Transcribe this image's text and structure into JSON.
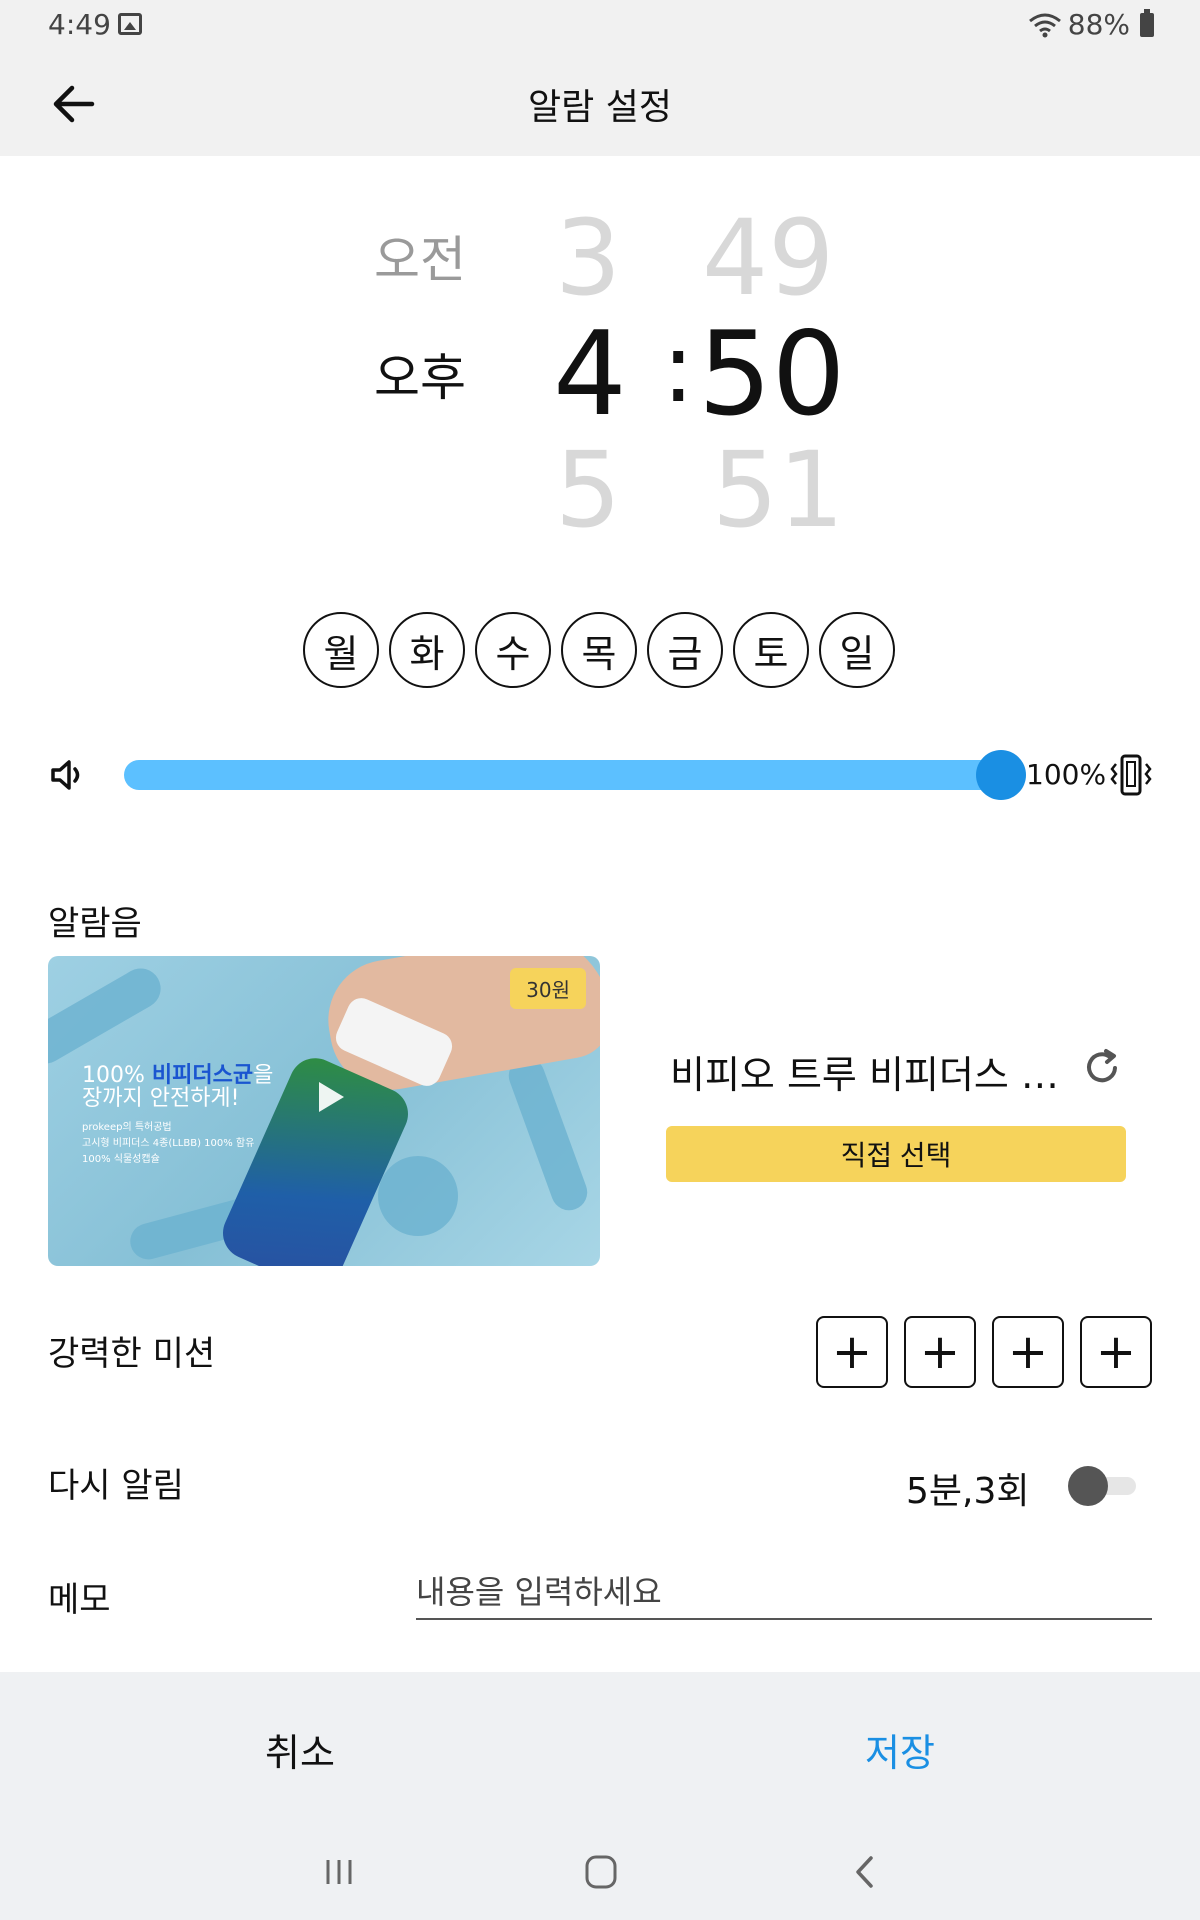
{
  "status_bar": {
    "time": "4:49",
    "battery": "88%"
  },
  "app_bar": {
    "title": "알람 설정"
  },
  "time_picker": {
    "am_label": "오전",
    "pm_label": "오후",
    "hour_prev": "3",
    "hour_current": "4",
    "hour_next": "5",
    "separator": ":",
    "minute_prev": "49",
    "minute_current": "50",
    "minute_next": "51"
  },
  "days": [
    "월",
    "화",
    "수",
    "목",
    "금",
    "토",
    "일"
  ],
  "volume": {
    "value": "100%",
    "level": 1.0
  },
  "alarm_sound": {
    "label": "알람음",
    "price_badge": "30원",
    "thumb_headline_a": "100% ",
    "thumb_headline_blue": "비피더스균",
    "thumb_headline_b": "을",
    "thumb_headline_line2": "장까지 안전하게!",
    "thumb_bullets": [
      "prokeep의 특허공법",
      "고시형 비피더스 4종(LLBB) 100% 함유",
      "100% 식물성캡슐"
    ],
    "name": "비피오 트루 비피더스 …",
    "select_button": "직접 선택"
  },
  "mission": {
    "label": "강력한 미션",
    "add_symbol": "+"
  },
  "snooze": {
    "label": "다시 알림",
    "value": "5분,3회",
    "enabled": false
  },
  "memo": {
    "label": "메모",
    "placeholder": "내용을 입력하세요"
  },
  "actions": {
    "cancel": "취소",
    "save": "저장"
  },
  "colors": {
    "accent": "#1a8fe3",
    "slider": "#5cc0ff",
    "button": "#f6d35b"
  }
}
